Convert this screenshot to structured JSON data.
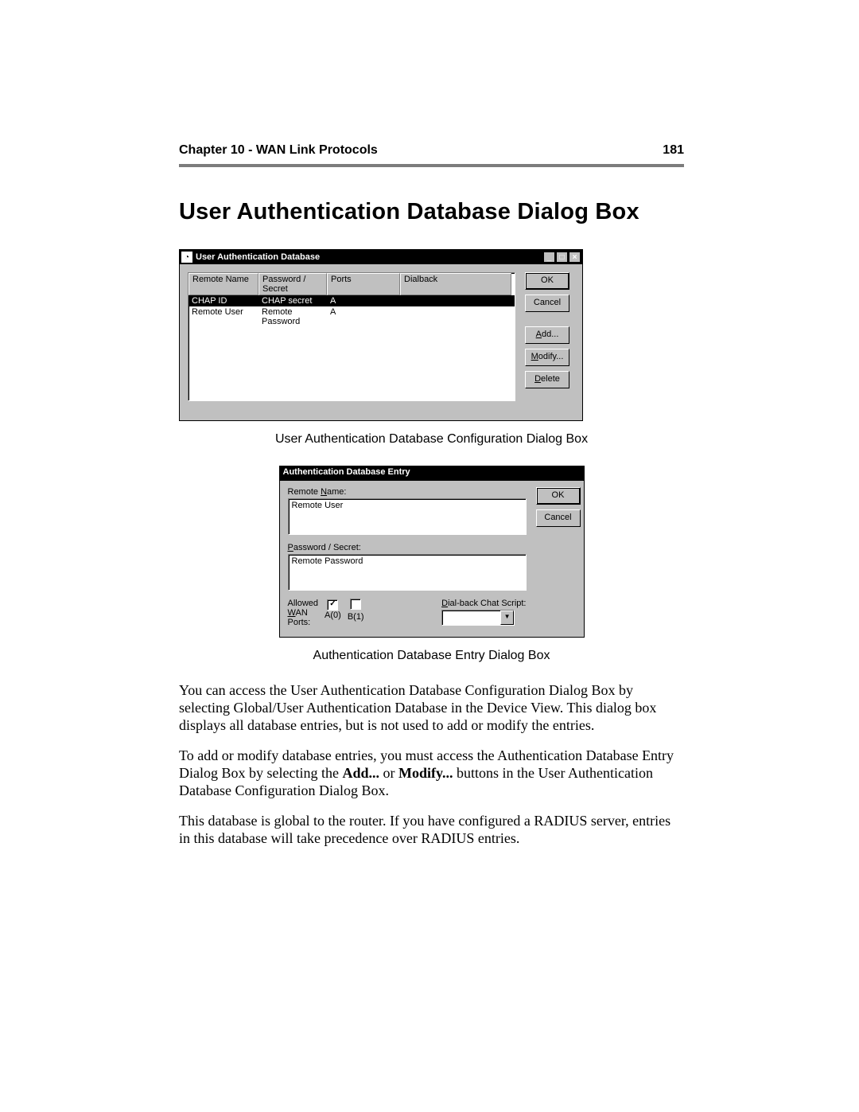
{
  "header": {
    "chapter": "Chapter 10 - WAN Link Protocols",
    "page_number": "181"
  },
  "title": "User Authentication Database Dialog Box",
  "dialog1": {
    "window_title": "User Authentication Database",
    "columns": {
      "name": "Remote Name",
      "secret": "Password / Secret",
      "ports": "Ports",
      "dialback": "Dialback"
    },
    "rows": [
      {
        "name": "CHAP ID",
        "secret": "CHAP secret",
        "ports": "A",
        "dialback": "",
        "selected": true
      },
      {
        "name": "Remote User",
        "secret": "Remote Password",
        "ports": "A",
        "dialback": "",
        "selected": false
      }
    ],
    "buttons": {
      "ok": "OK",
      "cancel": "Cancel",
      "add": "Add...",
      "modify": "Modify...",
      "delete": "Delete"
    },
    "caption": "User Authentication Database Configuration Dialog Box"
  },
  "dialog2": {
    "window_title": "Authentication Database Entry",
    "labels": {
      "remote_name": "Remote Name:",
      "password_secret": "Password / Secret:",
      "allowed_wan_ports": "Allowed\nWAN\nPorts:",
      "dialback_script": "Dial-back Chat Script:"
    },
    "values": {
      "remote_name": "Remote User",
      "password_secret": "Remote Password",
      "port_a_label": "A(0)",
      "port_b_label": "B(1)",
      "port_a_checked": true,
      "port_b_checked": false,
      "dialback_selected": ""
    },
    "buttons": {
      "ok": "OK",
      "cancel": "Cancel"
    },
    "caption": "Authentication Database Entry Dialog Box"
  },
  "paragraphs": {
    "p1": "You can access the User Authentication Database Configuration Dialog Box by selecting Global/User Authentication Database in the Device View. This dialog box displays all database entries, but is not used to add or modify the entries.",
    "p2_a": "To add or modify database entries, you must access the Authentication Database Entry Dialog Box by selecting the ",
    "p2_add": "Add...",
    "p2_or": " or ",
    "p2_mod": "Modify...",
    "p2_b": " buttons in the User Authentication Database Configuration Dialog Box.",
    "p3": "This database is global to the router. If you have configured a RADIUS server, entries in this database will take precedence over RADIUS entries."
  }
}
